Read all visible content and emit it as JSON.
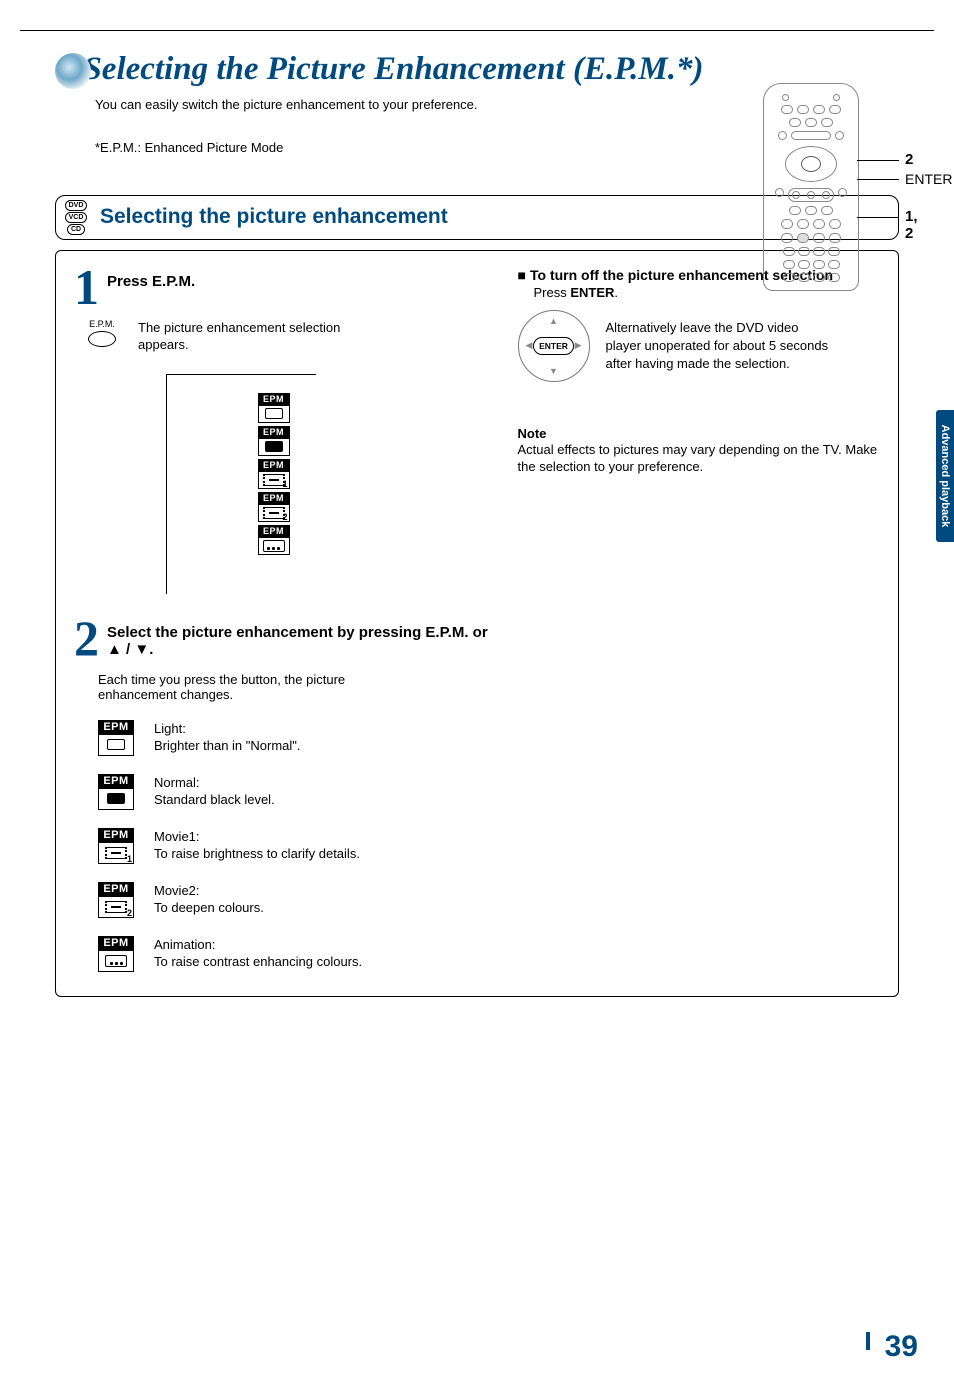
{
  "title": "Selecting the Picture Enhancement (E.P.M.*)",
  "intro": "You can easily switch the picture enhancement to your preference.",
  "footnote": "*E.P.M.: Enhanced Picture Mode",
  "remote_callouts": {
    "label_2": "2",
    "label_enter": "ENTER",
    "label_12": "1, 2"
  },
  "media_badges": [
    "DVD",
    "VCD",
    "CD"
  ],
  "section_title": "Selecting the picture enhancement",
  "step1": {
    "num": "1",
    "title": "Press E.P.M.",
    "button_label": "E.P.M.",
    "text": "The picture enhancement selection appears."
  },
  "step2": {
    "num": "2",
    "title": "Select the picture enhancement by pressing E.P.M. or ▲ / ▼.",
    "text": "Each time you press the button, the picture enhancement changes."
  },
  "modes": {
    "light": {
      "name": "Light:",
      "desc": "Brighter than in \"Normal\"."
    },
    "normal": {
      "name": "Normal:",
      "desc": "Standard black level."
    },
    "movie1": {
      "name": "Movie1:",
      "desc": "To raise brightness to clarify details."
    },
    "movie2": {
      "name": "Movie2:",
      "desc": "To deepen colours."
    },
    "animation": {
      "name": "Animation:",
      "desc": "To raise contrast enhancing colours."
    }
  },
  "turn_off": {
    "heading": "To turn off the picture enhancement selection",
    "press_line_prefix": "Press ",
    "press_line_key": "ENTER",
    "press_line_suffix": ".",
    "body": "Alternatively leave the DVD video player unoperated for about 5 seconds after having made the selection.",
    "enter_label": "ENTER"
  },
  "note": {
    "heading": "Note",
    "body": "Actual effects to pictures may vary depending on the TV. Make the selection to your preference."
  },
  "side_tab": "Advanced playback",
  "page_number": "39",
  "epm_osd_label": "EPM"
}
